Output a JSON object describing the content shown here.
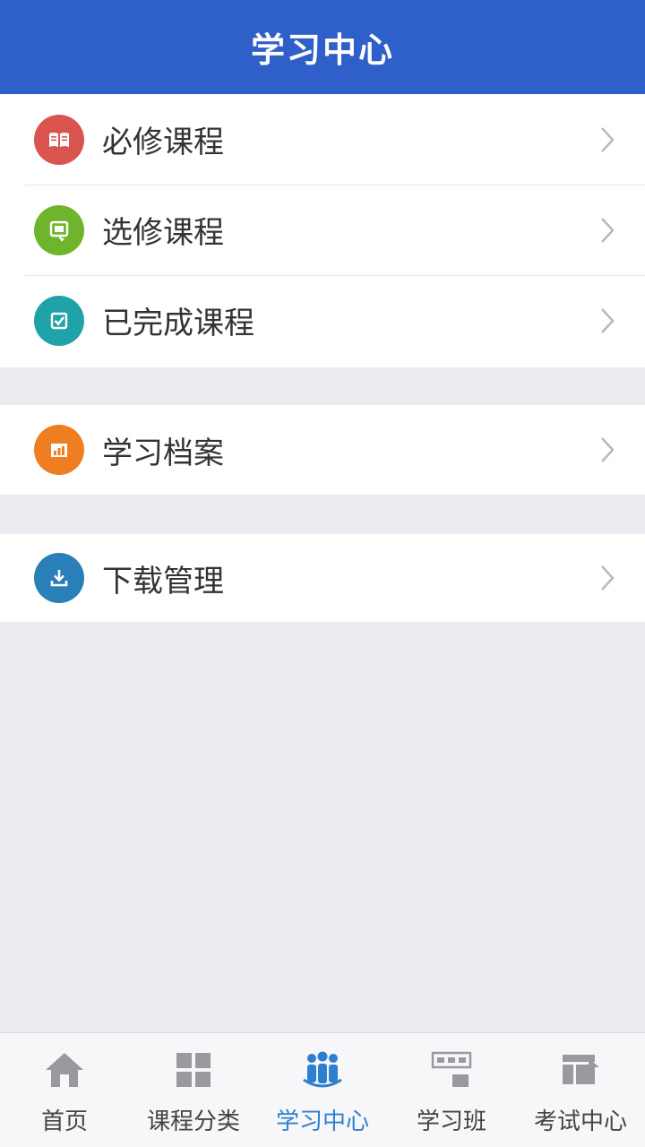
{
  "header": {
    "title": "学习中心"
  },
  "colors": {
    "header_bg": "#2f5fc8",
    "required_icon": "#d9534f",
    "elective_icon": "#6fb52c",
    "completed_icon": "#1fa3a8",
    "archive_icon": "#ef7d22",
    "download_icon": "#2a7fb8",
    "tab_active": "#2f7fd0"
  },
  "menu": {
    "group1": [
      {
        "label": "必修课程",
        "icon": "book-icon"
      },
      {
        "label": "选修课程",
        "icon": "elective-icon"
      },
      {
        "label": "已完成课程",
        "icon": "checkbox-icon"
      }
    ],
    "group2": [
      {
        "label": "学习档案",
        "icon": "chart-icon"
      }
    ],
    "group3": [
      {
        "label": "下载管理",
        "icon": "download-icon"
      }
    ]
  },
  "tabs": [
    {
      "label": "首页",
      "icon": "home-icon"
    },
    {
      "label": "课程分类",
      "icon": "grid-icon"
    },
    {
      "label": "学习中心",
      "icon": "people-icon",
      "active": true
    },
    {
      "label": "学习班",
      "icon": "class-icon"
    },
    {
      "label": "考试中心",
      "icon": "exam-icon"
    }
  ]
}
